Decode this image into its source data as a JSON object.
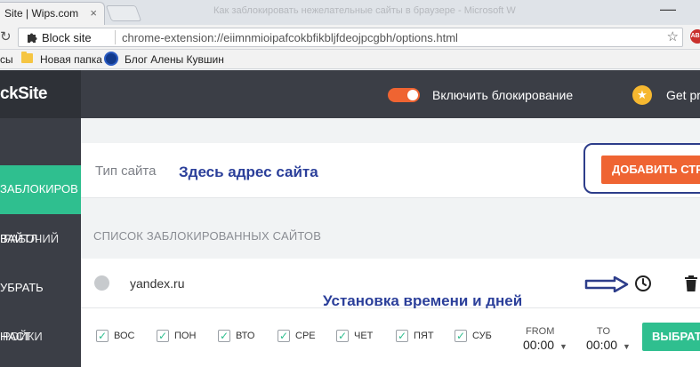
{
  "browser": {
    "tab_title": "Site | Wips.com",
    "tab_close": "×",
    "ghost_tab_text": "Как заблокировать нежелательные сайты в браузере - Microsoft Word",
    "window_min": "—",
    "site_name": "Block site",
    "url": "chrome-extension://eiimnmioipafcokbfikbljfdeojpcgbh/options.html",
    "star": "☆",
    "extension_badge": "ABP"
  },
  "bookmarks": [
    {
      "label": "сы"
    },
    {
      "label": "Новая папка"
    },
    {
      "label": "Блог Алены Кувшин"
    }
  ],
  "header": {
    "logo": "ckSite",
    "toggle_label": "Включить блокирование",
    "toggle_on": true,
    "get_pro": "Get pr"
  },
  "sidebar": {
    "items": [
      {
        "label": "ЗАБЛОКИРОВ",
        "active": true
      },
      {
        "label": "ВАЙТЛИСТ / РАБОЧИЙ",
        "active": false
      },
      {
        "label": "УБРАТЬ",
        "active": false
      },
      {
        "label": "НАСТРОЙКИ",
        "active": false
      }
    ]
  },
  "main": {
    "site_type_placeholder": "Тип сайта",
    "annotation_address": "Здесь адрес сайта",
    "add_button": "ДОБАВИТЬ СТР",
    "list_title": "СПИСОК ЗАБЛОКИРОВАННЫХ САЙТОВ",
    "site": "yandex.ru",
    "annotation_time": "Установка времени и дней",
    "days": [
      "ВОС",
      "ПОН",
      "ВТО",
      "СРЕ",
      "ЧЕТ",
      "ПЯТ",
      "СУБ"
    ],
    "checkmark": "✓",
    "from_label": "FROM",
    "from_value": "00:00",
    "to_label": "TO",
    "to_value": "00:00",
    "select_button": "ВЫБРАТЬ"
  },
  "colors": {
    "accent_orange": "#ef6432",
    "accent_green": "#2fbf8f",
    "annotation_blue": "#2b3f9a",
    "header_dark": "#3b3e46"
  }
}
